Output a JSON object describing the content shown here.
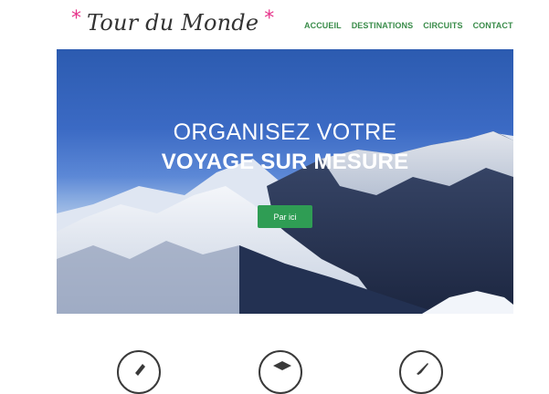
{
  "brand": {
    "star_left": "*",
    "title": "Tour du Monde",
    "star_right": "*",
    "accent_color": "#e6338a"
  },
  "nav": {
    "items": [
      {
        "label": "ACCUEIL"
      },
      {
        "label": "DESTINATIONS"
      },
      {
        "label": "CIRCUITS"
      },
      {
        "label": "CONTACT"
      }
    ],
    "color": "#3a8c4a"
  },
  "hero": {
    "line1": "ORGANISEZ VOTRE",
    "line2": "VOYAGE SUR MESURE",
    "cta_label": "Par ici",
    "cta_color": "#2f9d54"
  },
  "features": {
    "icons": [
      "pen-icon",
      "graduation-cap-icon",
      "plane-icon"
    ]
  }
}
